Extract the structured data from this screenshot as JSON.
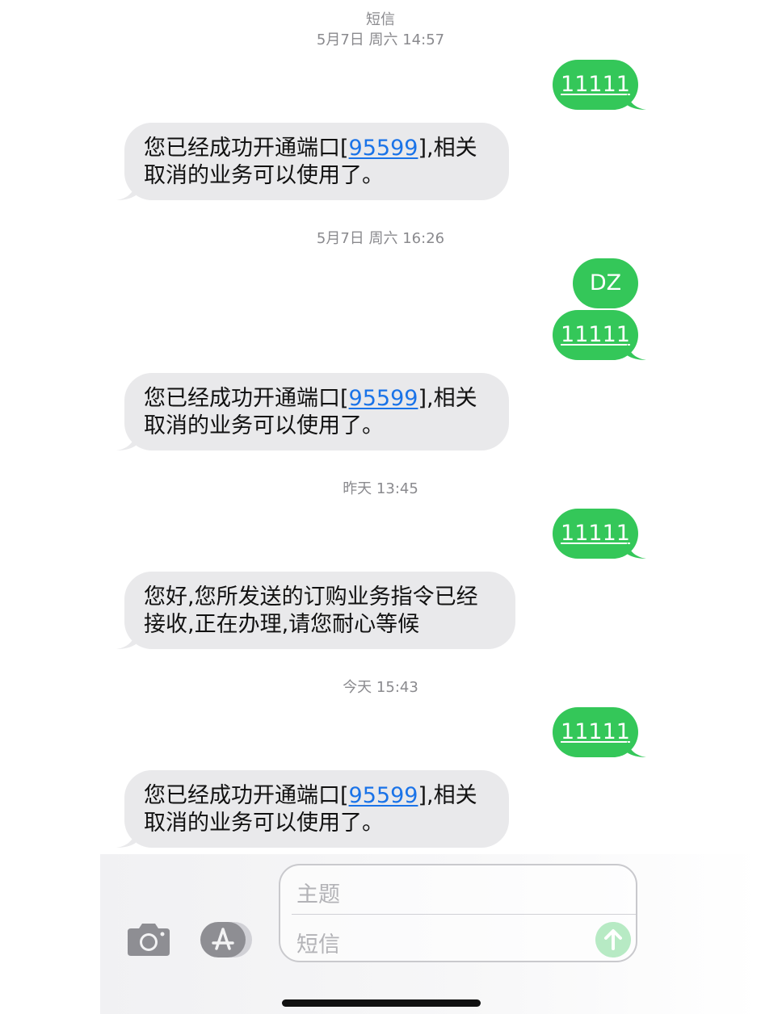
{
  "header": {
    "service": "短信"
  },
  "thread": {
    "timestamps": {
      "t1": "5月7日 周六 14:57",
      "t2": "5月7日 周六 16:26",
      "t3": "昨天 13:45",
      "t4": "今天 15:43"
    },
    "outgoing": {
      "m1": "11111",
      "m2": "DZ",
      "m3": "11111",
      "m4": "11111",
      "m5": "11111"
    },
    "incoming": {
      "r1": {
        "pre": "您已经成功开通端口[",
        "link": "95599",
        "post": "],相关",
        "line2": "取消的业务可以使用了。"
      },
      "r2": {
        "pre": "您已经成功开通端口[",
        "link": "95599",
        "post": "],相关",
        "line2": "取消的业务可以使用了。"
      },
      "r3": {
        "line1": "您好,您所发送的订购业务指令已经",
        "line2": "接收,正在办理,请您耐心等候"
      },
      "r4": {
        "pre": "您已经成功开通端口[",
        "link": "95599",
        "post": "],相关",
        "line2": "取消的业务可以使用了。"
      }
    }
  },
  "composer": {
    "subject_placeholder": "主题",
    "message_placeholder": "短信",
    "camera_icon": "camera-icon",
    "apps_icon": "app-store-icon",
    "send_icon": "arrow-up-icon"
  },
  "colors": {
    "outgoing_bubble": "#34c759",
    "incoming_bubble": "#e9e9eb",
    "link": "#1a73e8"
  }
}
